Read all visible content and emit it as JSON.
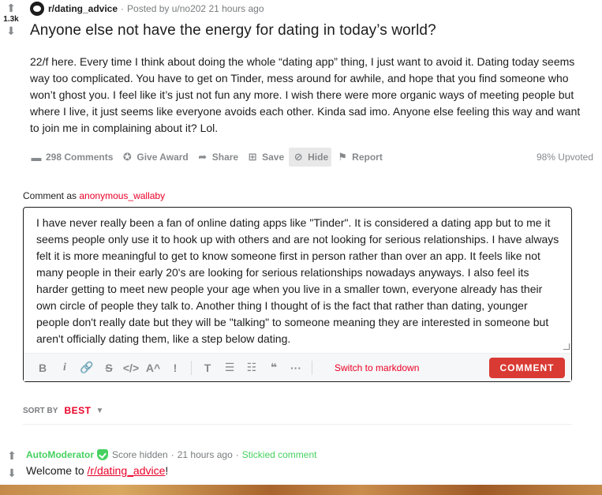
{
  "post": {
    "subreddit": "r/dating_advice",
    "separator": "·",
    "posted_by": "Posted by u/no202 21 hours ago",
    "vote_count": "1.3k",
    "title": "Anyone else not have the energy for dating in today’s world?",
    "body": "22/f here. Every time I think about doing the whole “dating app” thing, I just want to avoid it. Dating today seems way too complicated. You have to get on Tinder, mess around for awhile, and hope that you find someone who won’t ghost you. I feel like it’s just not fun any more. I wish there were more organic ways of meeting people but where I live, it just seems like everyone avoids each other. Kinda sad imo. Anyone else feeling this way and want to join me in complaining about it? Lol."
  },
  "actions": {
    "comments": "298 Comments",
    "award": "Give Award",
    "share": "Share",
    "save": "Save",
    "hide": "Hide",
    "report": "Report",
    "upvoted": "98% Upvoted"
  },
  "composer": {
    "comment_as_label": "Comment as",
    "username": "anonymous_wallaby",
    "text": "I have never really been a fan of online dating apps like \"Tinder\". It is considered a dating app but to me it seems people only use it to hook up with others and are not looking for serious relationships. I have always felt it is more meaningful to get to know someone first in person rather than over an app. It feels like not many people in their early 20's are looking for serious relationships nowadays anyways. I also feel its harder getting to meet new people your age when you live in a smaller town, everyone already has their own circle of people they talk to. Another thing I thought of is the fact that rather than dating, younger people don't really date but they will be \"talking\" to someone meaning they are interested in someone but aren't officially dating them, like a step below dating.",
    "switch_markdown": "Switch to markdown",
    "comment_button": "COMMENT",
    "toolbar": {
      "bold": "B",
      "italic": "i",
      "link": "🔗",
      "strike": "S",
      "code": "</>",
      "superscript": "A^",
      "spoiler": "!",
      "heading": "T",
      "bullets": "☰",
      "numbered": "☷",
      "quote": "❝",
      "more": "···"
    }
  },
  "sort": {
    "label": "SORT BY",
    "value": "BEST"
  },
  "comment": {
    "author": "AutoModerator",
    "score": "Score hidden",
    "time": "21 hours ago",
    "stickied": "Stickied comment",
    "body_prefix": "Welcome to ",
    "link": "/r/dating_advice",
    "body_suffix": "!"
  },
  "colors": {
    "accent": "#ea0027",
    "comment_button": "#d93a33",
    "mod_green": "#46d160"
  }
}
